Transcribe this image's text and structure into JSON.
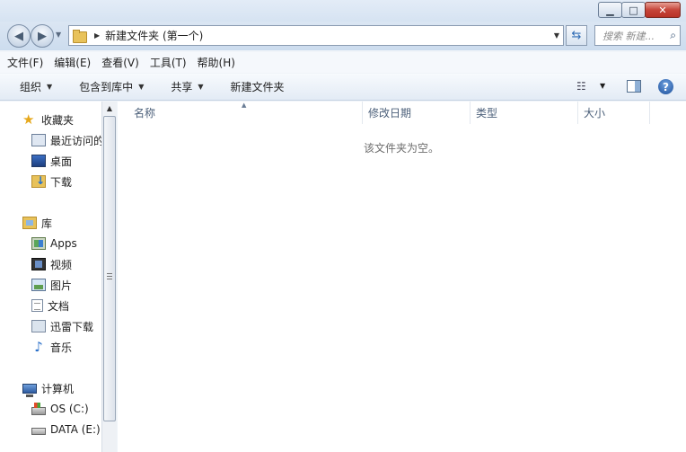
{
  "window": {
    "min_glyph": "▁",
    "max_glyph": "□",
    "close_glyph": "✕"
  },
  "address": {
    "back_glyph": "◀",
    "forward_glyph": "▶",
    "crumb": "新建文件夹 (第一个)",
    "search_placeholder": "搜索 新建...",
    "refresh_glyph": "⇆",
    "search_glyph": "⌕"
  },
  "menu": [
    "文件(F)",
    "编辑(E)",
    "查看(V)",
    "工具(T)",
    "帮助(H)"
  ],
  "toolbar": {
    "organize": "组织",
    "include_in_library": "包含到库中",
    "share": "共享",
    "new_folder": "新建文件夹",
    "help_glyph": "?",
    "view_glyph": "☷"
  },
  "nav": {
    "favorites": "收藏夹",
    "recent": "最近访问的",
    "desktop": "桌面",
    "downloads": "下载",
    "libraries": "库",
    "apps": "Apps",
    "videos": "视频",
    "pictures": "图片",
    "documents": "文档",
    "thunder": "迅雷下载",
    "music": "音乐",
    "computer": "计算机",
    "os_drive": "OS (C:)",
    "data_drive": "DATA (E:)",
    "star_glyph": "★",
    "music_glyph": "♪"
  },
  "columns": {
    "name": "名称",
    "modified": "修改日期",
    "type": "类型",
    "size": "大小"
  },
  "empty_message": "该文件夹为空。"
}
